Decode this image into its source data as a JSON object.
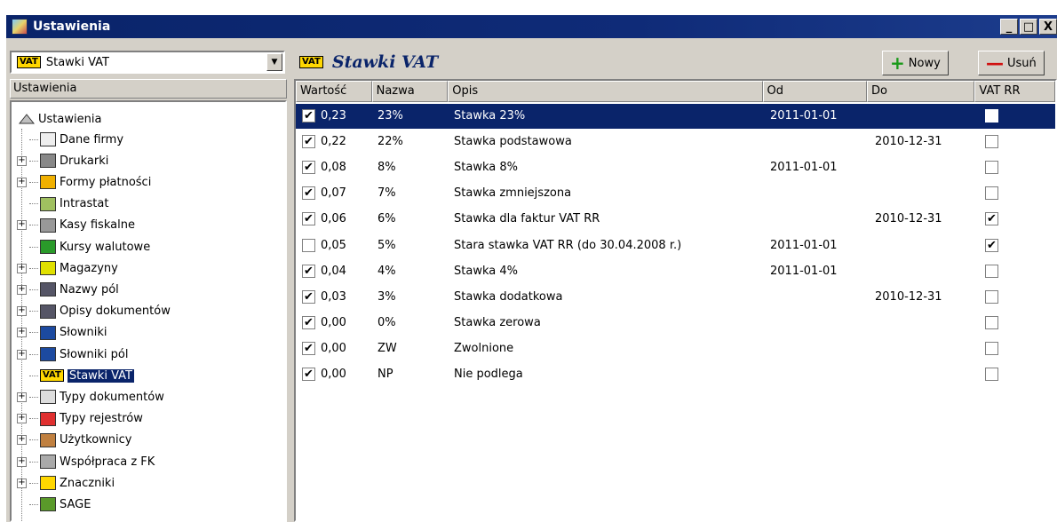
{
  "window": {
    "title": "Ustawienia",
    "buttons": [
      "_",
      "□",
      "X"
    ]
  },
  "left": {
    "combo_value": "Stawki VAT",
    "header": "Ustawienia",
    "root": "Ustawienia",
    "items": [
      {
        "label": "Dane firmy",
        "expandable": false,
        "icon": "company-card-icon"
      },
      {
        "label": "Drukarki",
        "expandable": true,
        "icon": "printer-icon"
      },
      {
        "label": "Formy płatności",
        "expandable": true,
        "icon": "payment-icon"
      },
      {
        "label": "Intrastat",
        "expandable": false,
        "icon": "intrastat-icon"
      },
      {
        "label": "Kasy fiskalne",
        "expandable": true,
        "icon": "cash-register-icon"
      },
      {
        "label": "Kursy walutowe",
        "expandable": false,
        "icon": "currency-table-icon"
      },
      {
        "label": "Magazyny",
        "expandable": true,
        "icon": "warehouse-icon"
      },
      {
        "label": "Nazwy pól",
        "expandable": true,
        "icon": "field-names-icon"
      },
      {
        "label": "Opisy dokumentów",
        "expandable": true,
        "icon": "document-descriptions-icon"
      },
      {
        "label": "Słowniki",
        "expandable": true,
        "icon": "dictionary-icon"
      },
      {
        "label": "Słowniki pól",
        "expandable": true,
        "icon": "field-dictionary-icon"
      },
      {
        "label": "Stawki VAT",
        "expandable": false,
        "icon": "vat-icon",
        "selected": true
      },
      {
        "label": "Typy dokumentów",
        "expandable": true,
        "icon": "document-types-icon"
      },
      {
        "label": "Typy rejestrów",
        "expandable": true,
        "icon": "register-types-icon"
      },
      {
        "label": "Użytkownicy",
        "expandable": true,
        "icon": "users-icon"
      },
      {
        "label": "Współpraca z FK",
        "expandable": true,
        "icon": "fk-sync-icon"
      },
      {
        "label": "Znaczniki",
        "expandable": true,
        "icon": "markers-icon"
      },
      {
        "label": "SAGE",
        "expandable": false,
        "icon": "sage-icon"
      }
    ]
  },
  "right": {
    "title": "Stawki VAT",
    "vat_badge": "VAT",
    "new_button": "Nowy",
    "delete_button": "Usuń",
    "columns": [
      "Wartość",
      "Nazwa",
      "Opis",
      "Od",
      "Do",
      "VAT RR"
    ],
    "rows": [
      {
        "checked": true,
        "value": "0,23",
        "name": "23%",
        "desc": "Stawka 23%",
        "from": "2011-01-01",
        "to": "",
        "vatrr": false
      },
      {
        "checked": true,
        "value": "0,22",
        "name": "22%",
        "desc": "Stawka podstawowa",
        "from": "",
        "to": "2010-12-31",
        "vatrr": false
      },
      {
        "checked": true,
        "value": "0,08",
        "name": "8%",
        "desc": "Stawka 8%",
        "from": "2011-01-01",
        "to": "",
        "vatrr": false
      },
      {
        "checked": true,
        "value": "0,07",
        "name": "7%",
        "desc": "Stawka zmniejszona",
        "from": "",
        "to": "",
        "vatrr": false
      },
      {
        "checked": true,
        "value": "0,06",
        "name": "6%",
        "desc": "Stawka dla faktur VAT RR",
        "from": "",
        "to": "2010-12-31",
        "vatrr": true
      },
      {
        "checked": false,
        "value": "0,05",
        "name": "5%",
        "desc": "Stara stawka VAT RR (do 30.04.2008 r.)",
        "from": "2011-01-01",
        "to": "",
        "vatrr": true
      },
      {
        "checked": true,
        "value": "0,04",
        "name": "4%",
        "desc": "Stawka 4%",
        "from": "2011-01-01",
        "to": "",
        "vatrr": false
      },
      {
        "checked": true,
        "value": "0,03",
        "name": "3%",
        "desc": "Stawka dodatkowa",
        "from": "",
        "to": "2010-12-31",
        "vatrr": false
      },
      {
        "checked": true,
        "value": "0,00",
        "name": "0%",
        "desc": "Stawka zerowa",
        "from": "",
        "to": "",
        "vatrr": false
      },
      {
        "checked": true,
        "value": "0,00",
        "name": "ZW",
        "desc": "Zwolnione",
        "from": "",
        "to": "",
        "vatrr": false
      },
      {
        "checked": true,
        "value": "0,00",
        "name": "NP",
        "desc": "Nie podlega",
        "from": "",
        "to": "",
        "vatrr": false
      }
    ]
  }
}
